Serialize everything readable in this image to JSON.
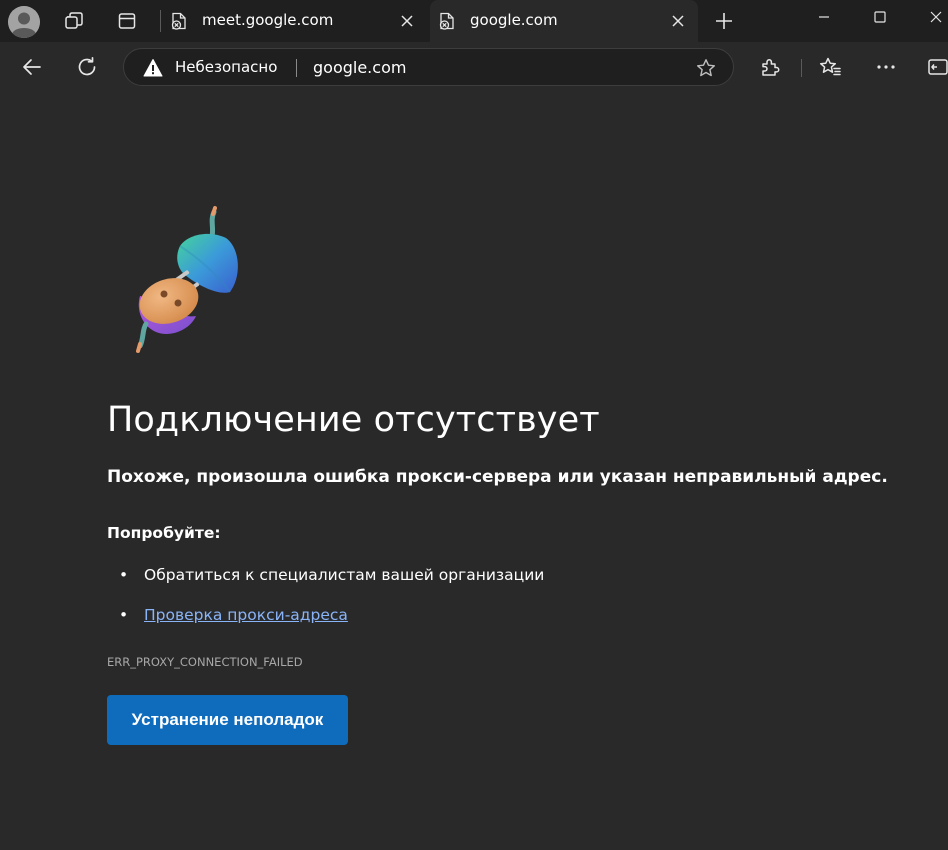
{
  "tabs": [
    {
      "title": "meet.google.com",
      "active": false,
      "favicon": "page-error-icon"
    },
    {
      "title": "google.com",
      "active": true,
      "favicon": "page-error-icon"
    }
  ],
  "address_bar": {
    "security_status": "Небезопасно",
    "url": "google.com"
  },
  "error_page": {
    "title": "Подключение отсутствует",
    "subtitle": "Похоже, произошла ошибка прокси-сервера или указан неправильный адрес.",
    "try_label": "Попробуйте:",
    "suggestions": [
      {
        "text": "Обратиться к специалистам вашей организации",
        "is_link": false
      },
      {
        "text": "Проверка прокси-адреса",
        "is_link": true
      }
    ],
    "error_code": "ERR_PROXY_CONNECTION_FAILED",
    "fix_button_label": "Устранение неполадок"
  },
  "colors": {
    "page_background": "#292929",
    "frame_background": "#1f1f1f",
    "accent_button": "#0f6cbd",
    "link": "#8ab4f8"
  },
  "icons": {
    "profile": "profile-avatar-icon",
    "workspaces": "workspaces-icon",
    "tab_actions": "tab-actions-icon",
    "new_tab": "plus-icon",
    "minimize": "minimize-icon",
    "maximize": "maximize-icon",
    "close": "close-icon",
    "back": "back-arrow-icon",
    "refresh": "refresh-icon",
    "warning": "warning-triangle-icon",
    "favorite": "star-icon",
    "extensions": "puzzle-icon",
    "favorites": "favorites-icon",
    "more": "more-dots-icon",
    "sidebar": "sidebar-icon",
    "illustration": "unplugged-plug-illustration"
  }
}
